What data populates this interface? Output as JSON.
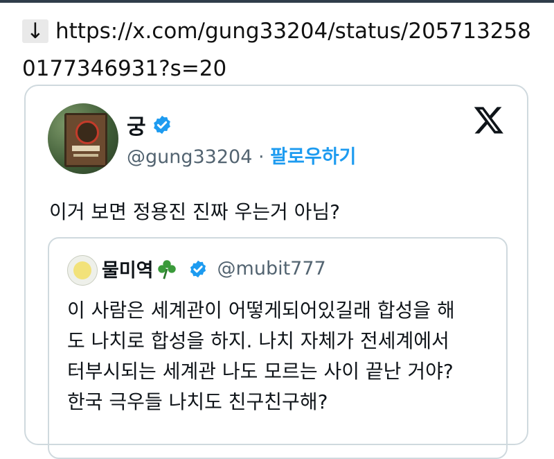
{
  "link": {
    "arrow": "↓",
    "url": "https://x.com/gung33204/status/2057132580177346931?s=20"
  },
  "tweet": {
    "author_name": "궁",
    "handle": "@gung33204",
    "separator": "·",
    "follow_label": "팔로우하기",
    "verified": true,
    "text": "이거 보면 정용진 진짜 우는거 아님?",
    "brand_icon": "x-logo-icon"
  },
  "quoted": {
    "author_name": "물미역",
    "handle": "@mubit777",
    "verified": true,
    "name_emoji": "clover-icon",
    "lines": [
      "이 사람은 세계관이 어떻게되어있길래 합성을 해",
      "도 나치로 합성을 하지. 나치 자체가 전세계에서",
      "터부시되는 세계관 나도 모르는 사이 끝난 거야?",
      "한국 극우들 나치도 친구친구해?"
    ]
  },
  "colors": {
    "accent": "#1d9bf0",
    "border": "#cfd9de",
    "muted": "#536471",
    "text": "#0f1419"
  }
}
